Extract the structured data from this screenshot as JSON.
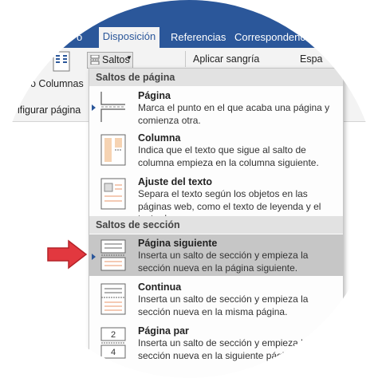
{
  "tabs": {
    "prev": "o",
    "active": "Disposición",
    "referencias": "Referencias",
    "correspondencia": "Correspondenci"
  },
  "ribbon": {
    "saltos_label": "Saltos",
    "columnas_label": "o Columnas",
    "configurar_label": "ifigurar página",
    "sangria_label": "Aplicar sangría",
    "espaciado_label": "Espa"
  },
  "menu": {
    "section_page": "Saltos de página",
    "section_section": "Saltos de sección",
    "items": [
      {
        "title": "Página",
        "desc": "Marca el punto en el que acaba una página y comienza otra."
      },
      {
        "title": "Columna",
        "desc": "Indica que el texto que sigue al salto de columna empieza en la columna siguiente."
      },
      {
        "title": "Ajuste del texto",
        "desc": "Separa el texto según los objetos en las páginas web, como el texto de leyenda y el texto de cuerpo."
      },
      {
        "title": "Página siguiente",
        "desc": "Inserta un salto de sección y empieza la sección nueva en la página siguiente."
      },
      {
        "title": "Continua",
        "desc": "Inserta un salto de sección y empieza la sección nueva en la misma página."
      },
      {
        "title": "Página par",
        "desc": "Inserta un salto de sección y empieza la sección nueva en la siguiente página con"
      }
    ],
    "highlighted_index": 3
  },
  "colors": {
    "ribbon_blue": "#2b579a",
    "highlight": "#c6c6c6",
    "arrow_red": "#e2383f"
  },
  "icons": {
    "columnas": "columns-icon",
    "saltos": "breaks-icon",
    "arrow": "red-pointer-arrow"
  }
}
